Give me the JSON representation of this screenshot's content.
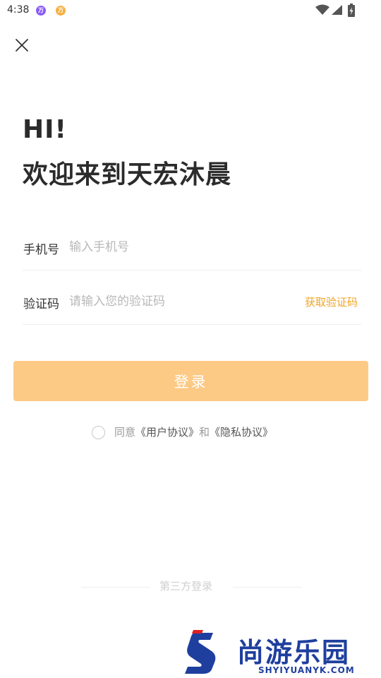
{
  "status_bar": {
    "time": "4:38",
    "notif_icons": [
      "notification-app-icon",
      "notification-app-icon"
    ],
    "notif_glyph": "万",
    "icons": [
      "wifi-icon",
      "signal-icon",
      "battery-charging-icon"
    ]
  },
  "close_icon": "close-icon",
  "greeting": {
    "line1": "HI!",
    "line2": "欢迎来到天宏沐晨"
  },
  "form": {
    "phone_label": "手机号",
    "phone_placeholder": "输入手机号",
    "phone_value": "",
    "code_label": "验证码",
    "code_placeholder": "请输入您的验证码",
    "code_value": "",
    "get_code": "获取验证码"
  },
  "login_button": "登录",
  "agreement": {
    "prefix": "同意",
    "user_agreement": "《用户协议》",
    "and": "和",
    "privacy_agreement": "《隐私协议》",
    "checked": false
  },
  "third_party_label": "第三方登录",
  "watermark": {
    "text": "尚游乐园",
    "url": "SHYIYUANYK.COM"
  },
  "colors": {
    "accent": "#f0a426",
    "login_button_bg": "#fdca85",
    "watermark_blue": "#1f3f9e"
  }
}
